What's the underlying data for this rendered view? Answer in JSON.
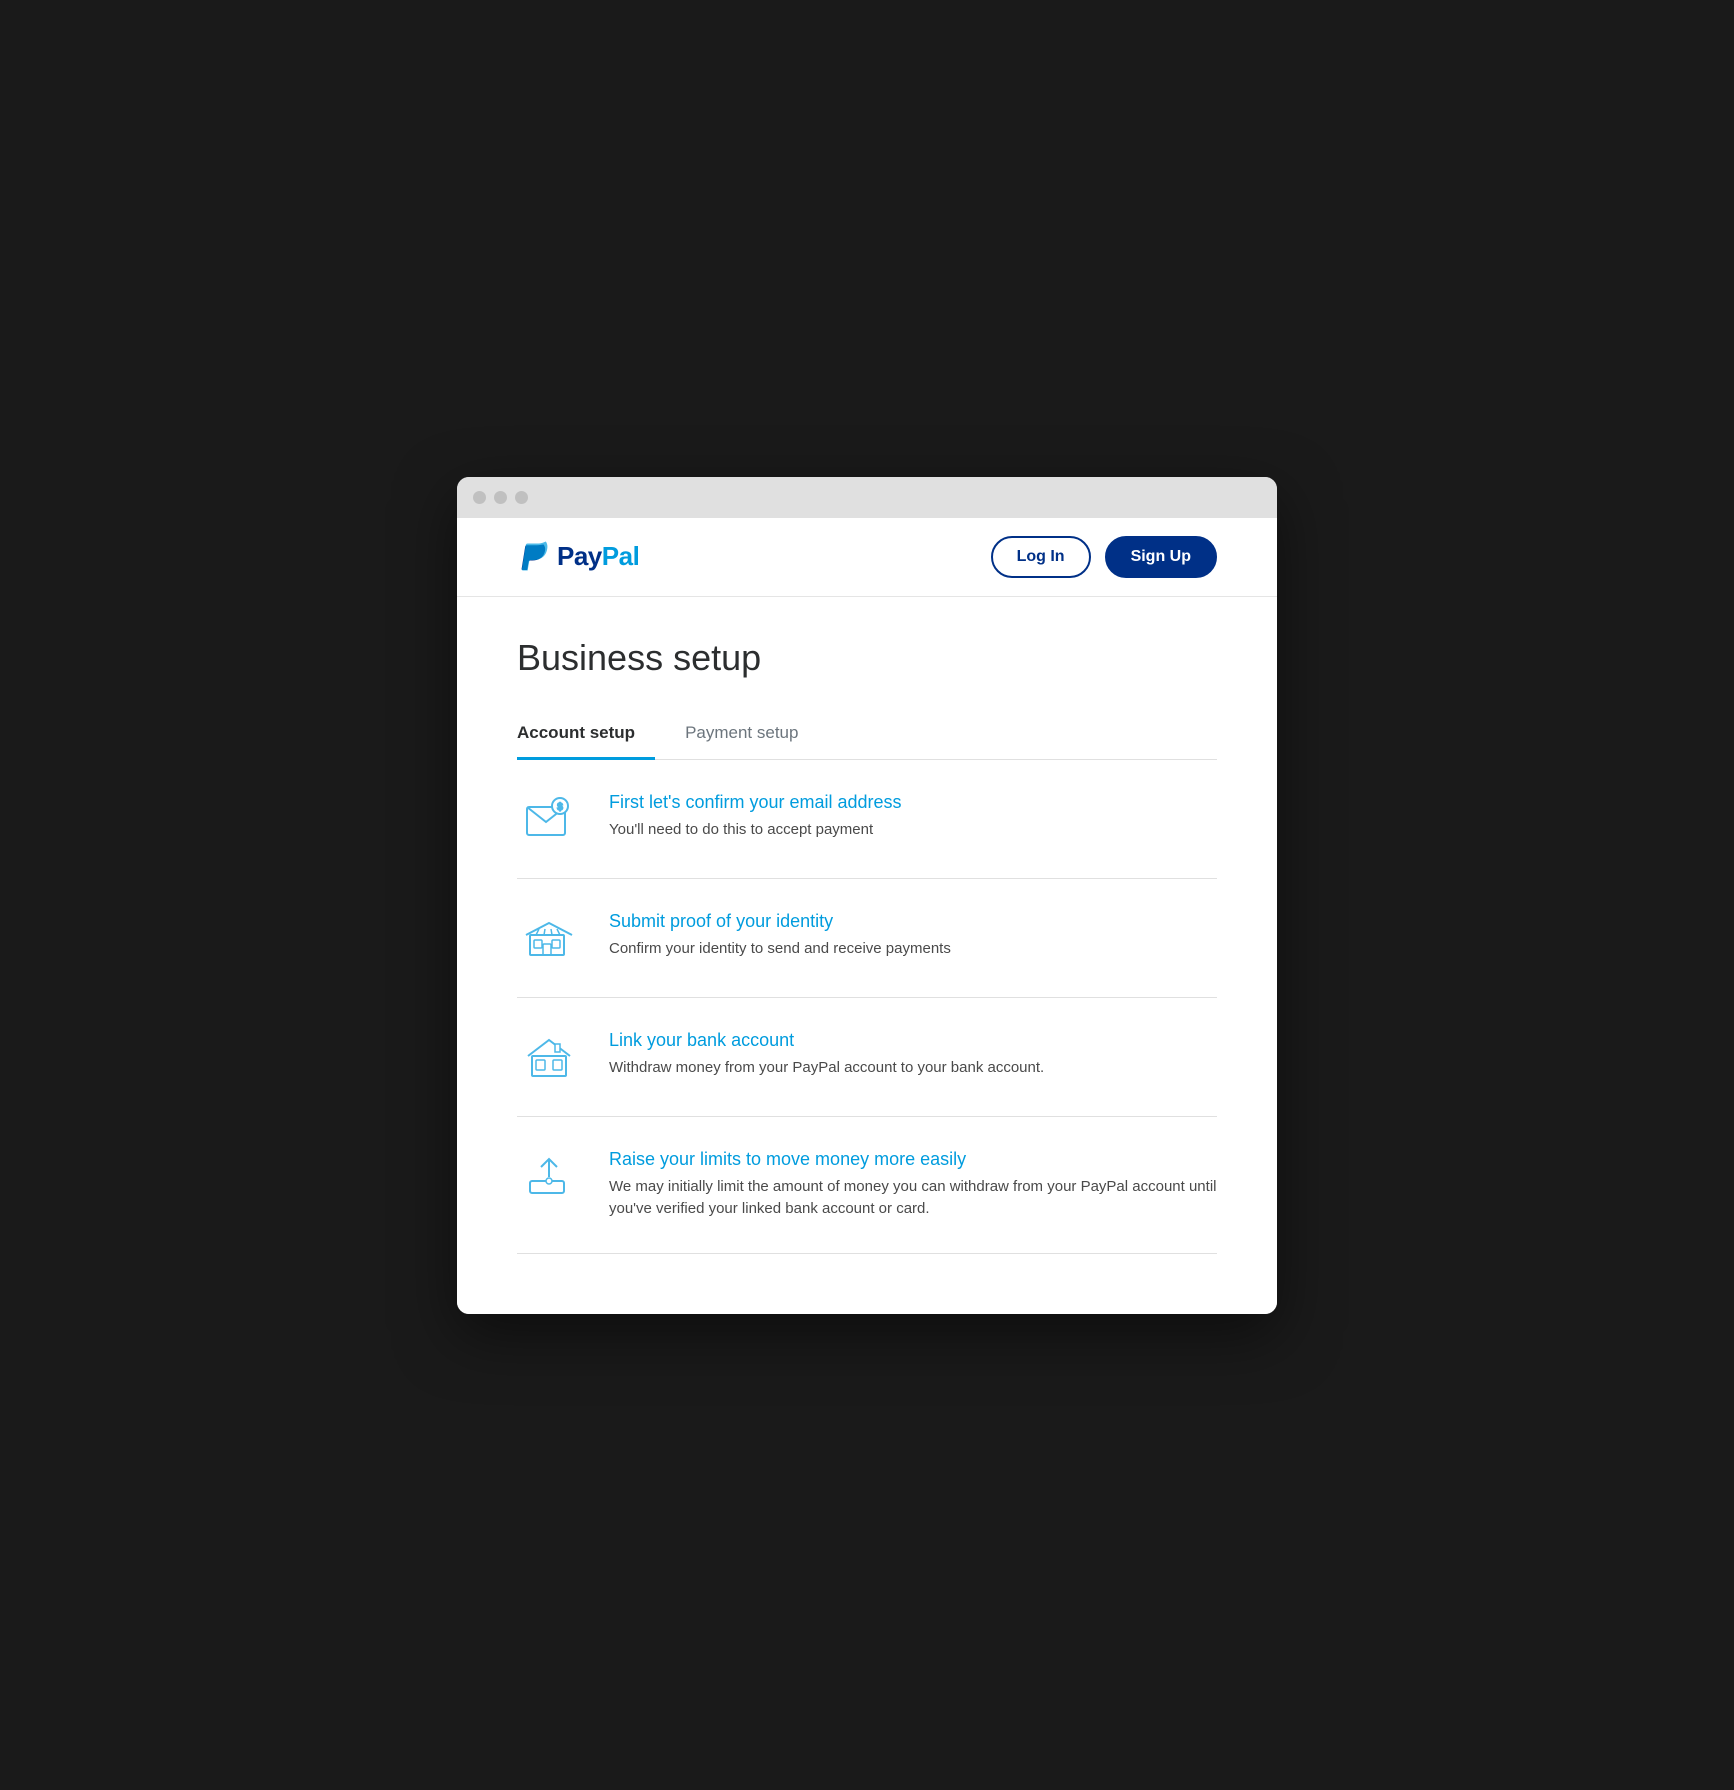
{
  "browser": {
    "traffic_lights": [
      "close",
      "minimize",
      "maximize"
    ]
  },
  "header": {
    "logo_pay": "Pay",
    "logo_pal": "Pal",
    "login_label": "Log In",
    "signup_label": "Sign Up"
  },
  "page": {
    "title": "Business setup",
    "tabs": [
      {
        "id": "account-setup",
        "label": "Account setup",
        "active": true
      },
      {
        "id": "payment-setup",
        "label": "Payment setup",
        "active": false
      }
    ],
    "setup_items": [
      {
        "id": "confirm-email",
        "title": "First let's confirm your email address",
        "description": "You'll need to do this to accept payment",
        "icon": "email"
      },
      {
        "id": "submit-identity",
        "title": "Submit proof of your identity",
        "description": "Confirm your identity to send and receive payments",
        "icon": "store"
      },
      {
        "id": "link-bank",
        "title": "Link your bank account",
        "description": "Withdraw money from your PayPal account to your bank account.",
        "icon": "bank"
      },
      {
        "id": "raise-limits",
        "title": "Raise your limits to move money more easily",
        "description": "We may initially limit the amount of money you can withdraw from your PayPal account until you've verified your linked bank account or card.",
        "icon": "upload"
      }
    ]
  }
}
